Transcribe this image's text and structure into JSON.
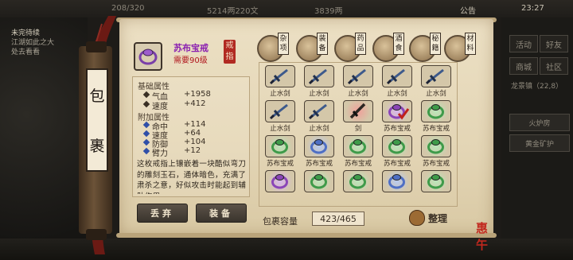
{
  "topbar": {
    "stat_a": "208/320",
    "money_a": "5214两220文",
    "money_b": "3839两",
    "announce": "公告",
    "time": "23:27"
  },
  "quest": {
    "title": "未完待续",
    "line1": "江湖如此之大",
    "line2": "处去看看"
  },
  "right_panel": {
    "btn_1": "活动",
    "btn_2": "好友",
    "btn_3": "商城",
    "btn_4": "社区",
    "location": "龙景镇（22,8）",
    "skill_1": "火炉房",
    "skill_2": "黄金矿护"
  },
  "bag_title": [
    "包",
    "裹"
  ],
  "item": {
    "name": "苏布宝戒",
    "requirement": "需要90级",
    "seal": [
      "戒",
      "指"
    ],
    "base_title": "基础属性",
    "base_stats": [
      {
        "name": "气血",
        "value": "+1958"
      },
      {
        "name": "速度",
        "value": "+412"
      }
    ],
    "extra_title": "附加属性",
    "extra_stats": [
      {
        "name": "命中",
        "value": "+114"
      },
      {
        "name": "速度",
        "value": "+64"
      },
      {
        "name": "防御",
        "value": "+104"
      },
      {
        "name": "臂力",
        "value": "+12"
      }
    ],
    "description": "这枚戒指上镶嵌着一块酷似弯刀的雕刻玉石，通体暗色，充满了肃杀之意，好似攻击时能起到辅助作用。"
  },
  "buttons": {
    "discard": "丢弃",
    "equip": "装备"
  },
  "categories": [
    {
      "label": [
        "杂",
        "项"
      ],
      "icon": "bag-icon"
    },
    {
      "label": [
        "装",
        "备"
      ],
      "icon": "armor-icon"
    },
    {
      "label": [
        "药",
        "品"
      ],
      "icon": "medicine-icon"
    },
    {
      "label": [
        "酒",
        "食"
      ],
      "icon": "food-icon"
    },
    {
      "label": [
        "秘",
        "籍"
      ],
      "icon": "book-icon"
    },
    {
      "label": [
        "材",
        "料"
      ],
      "icon": "material-icon"
    }
  ],
  "grid": [
    [
      {
        "type": "sword",
        "glow": "none",
        "label": "止水剑"
      },
      {
        "type": "sword",
        "glow": "none",
        "label": "止水剑"
      },
      {
        "type": "sword",
        "glow": "none",
        "label": "止水剑"
      },
      {
        "type": "sword",
        "glow": "none",
        "label": "止水剑"
      },
      {
        "type": "sword",
        "glow": "none",
        "label": "止水剑"
      }
    ],
    [
      {
        "type": "sword",
        "glow": "none",
        "label": "止水剑"
      },
      {
        "type": "sword",
        "glow": "none",
        "label": "止水剑"
      },
      {
        "type": "blade",
        "glow": "red",
        "label": "剑"
      },
      {
        "type": "ring",
        "glow": "purple",
        "label": "苏布宝戒",
        "checked": true
      },
      {
        "type": "ring",
        "glow": "green",
        "label": "苏布宝戒"
      }
    ],
    [
      {
        "type": "ring",
        "glow": "green",
        "label": "苏布宝戒"
      },
      {
        "type": "ring",
        "glow": "blue",
        "label": "苏布宝戒"
      },
      {
        "type": "ring",
        "glow": "green",
        "label": "苏布宝戒"
      },
      {
        "type": "ring",
        "glow": "green",
        "label": "苏布宝戒"
      },
      {
        "type": "ring",
        "glow": "green",
        "label": "苏布宝戒"
      }
    ],
    [
      {
        "type": "ring",
        "glow": "purple",
        "label": ""
      },
      {
        "type": "ring",
        "glow": "green",
        "label": ""
      },
      {
        "type": "ring",
        "glow": "green",
        "label": ""
      },
      {
        "type": "ring",
        "glow": "blue",
        "label": ""
      },
      {
        "type": "ring",
        "glow": "green",
        "label": ""
      }
    ]
  ],
  "capacity": {
    "label": "包裹容量",
    "value": "423/465"
  },
  "sort": {
    "label": "整理"
  },
  "stamp": "惠午",
  "colors": {
    "item_name": "#8a1fb0",
    "requirement": "#b0151d",
    "stat_blue": "#2f4fa8",
    "seal": "#b12a22"
  }
}
